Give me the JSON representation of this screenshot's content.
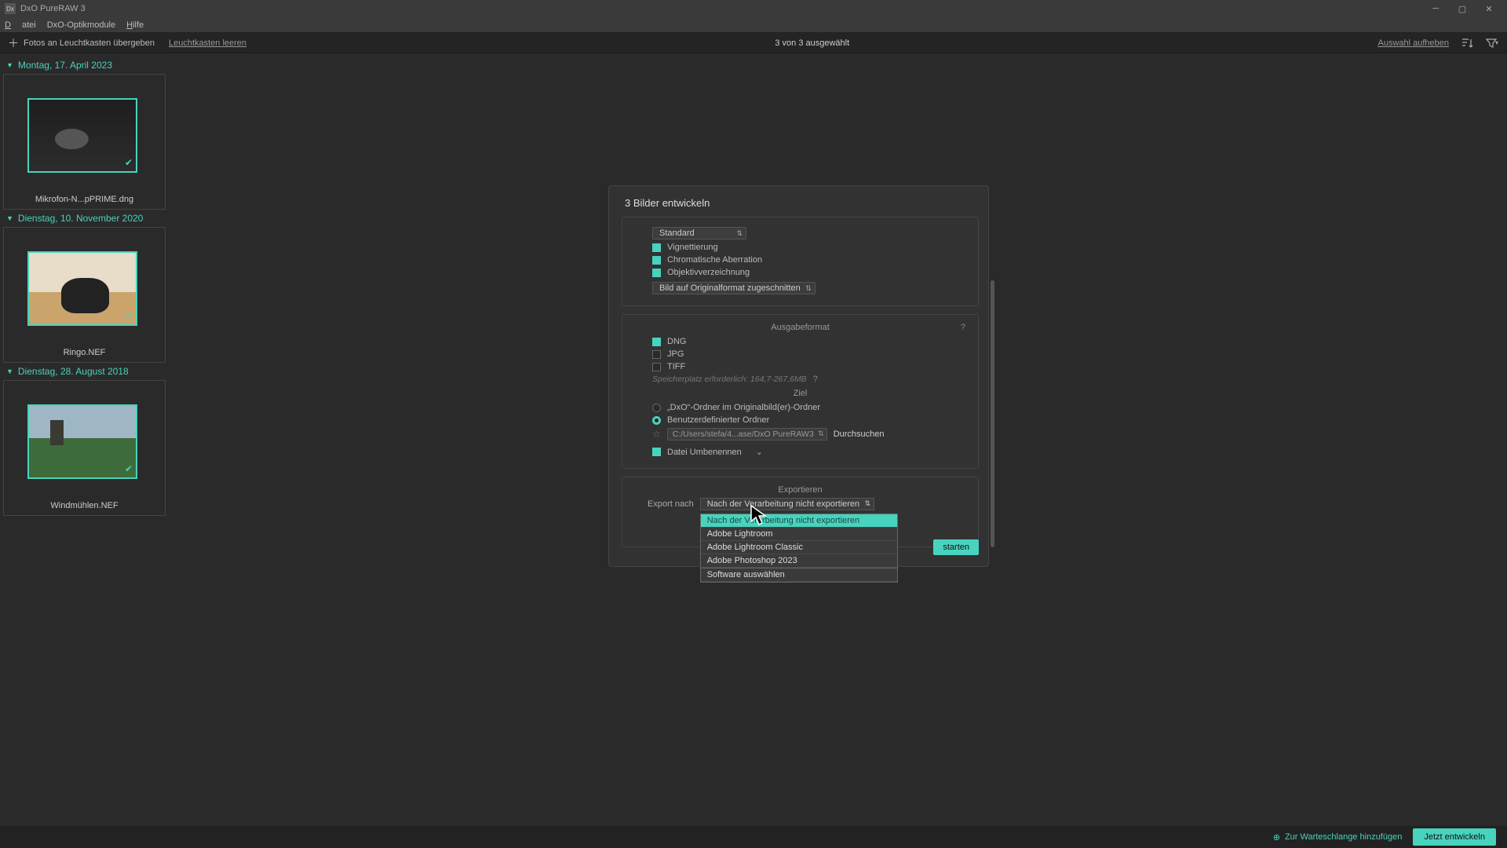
{
  "titlebar": {
    "app_name": "DxO PureRAW 3"
  },
  "menubar": {
    "file": "Datei",
    "modules": "DxO-Optikmodule",
    "help": "Hilfe"
  },
  "toolbar": {
    "add_label": "Fotos an Leuchtkasten übergeben",
    "clear_label": "Leuchtkasten leeren",
    "status": "3 von 3 ausgewählt",
    "deselect": "Auswahl aufheben"
  },
  "groups": [
    {
      "date": "Montag, 17. April 2023",
      "thumb_label": "Mikrofon-N...pPRIME.dng",
      "img": "mic"
    },
    {
      "date": "Dienstag, 10. November 2020",
      "thumb_label": "Ringo.NEF",
      "img": "dog"
    },
    {
      "date": "Dienstag, 28. August 2018",
      "thumb_label": "Windmühlen.NEF",
      "img": "mill"
    }
  ],
  "dialog": {
    "title": "3 Bilder entwickeln",
    "corr_select": "Standard",
    "corr": {
      "vignetting": "Vignettierung",
      "chroma": "Chromatische Aberration",
      "distortion": "Objektivverzeichnung"
    },
    "crop_select": "Bild auf Originalformat zugeschnitten",
    "output": {
      "title": "Ausgabeformat",
      "dng": "DNG",
      "jpg": "JPG",
      "tiff": "TIFF",
      "storage": "Speicherplatz erforderlich: 164,7-267,6MB"
    },
    "dest": {
      "title": "Ziel",
      "dxo_folder": "„DxO“-Ordner im Originalbild(er)-Ordner",
      "custom_folder": "Benutzerdefinierter Ordner",
      "path": "C:/Users/stefa/4...ase/DxO PureRAW3",
      "browse": "Durchsuchen",
      "rename": "Datei Umbenennen"
    },
    "export": {
      "title": "Exportieren",
      "label": "Export nach",
      "selected": "Nach der Verarbeitung nicht exportieren",
      "options": [
        "Nach der Verarbeitung nicht exportieren",
        "Adobe Lightroom",
        "Adobe Lightroom Classic",
        "Adobe Photoshop 2023",
        "Software auswählen"
      ]
    },
    "start_btn": "starten"
  },
  "footer": {
    "queue": "Zur Warteschlange hinzufügen",
    "develop": "Jetzt entwickeln"
  }
}
